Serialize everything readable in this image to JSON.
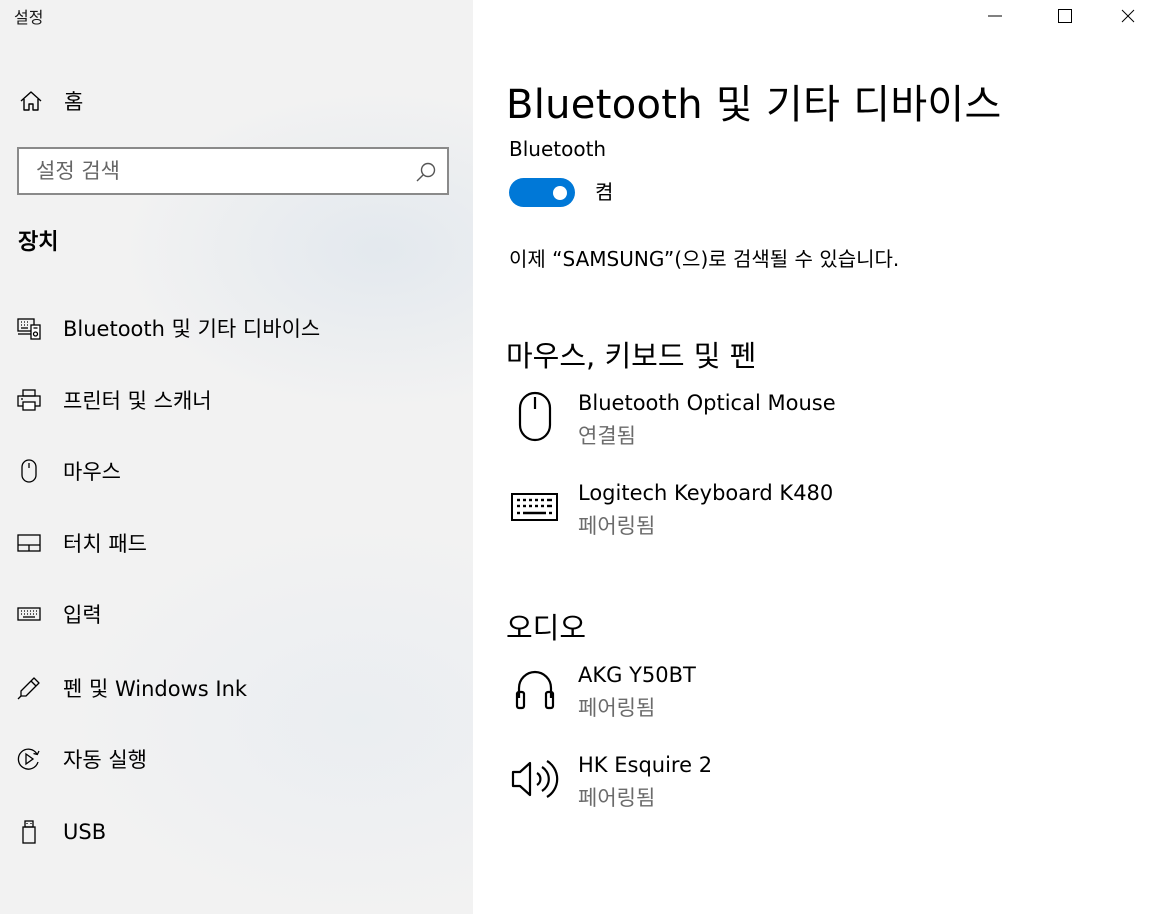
{
  "window": {
    "title": "설정"
  },
  "sidebar": {
    "home_label": "홈",
    "search_placeholder": "설정 검색",
    "section_title": "장치",
    "items": [
      {
        "label": "Bluetooth 및 기타 디바이스",
        "icon": "bluetooth-devices-icon"
      },
      {
        "label": "프린터 및 스캐너",
        "icon": "printer-icon"
      },
      {
        "label": "마우스",
        "icon": "mouse-icon"
      },
      {
        "label": "터치 패드",
        "icon": "touchpad-icon"
      },
      {
        "label": "입력",
        "icon": "keyboard-icon"
      },
      {
        "label": "펜 및 Windows Ink",
        "icon": "pen-icon"
      },
      {
        "label": "자동 실행",
        "icon": "autoplay-icon"
      },
      {
        "label": "USB",
        "icon": "usb-icon"
      }
    ]
  },
  "main": {
    "page_title": "Bluetooth 및 기타 디바이스",
    "bluetooth_label": "Bluetooth",
    "toggle_state": "켬",
    "toggle_on": true,
    "discoverable_text": "이제 “SAMSUNG”(으)로 검색될 수 있습니다.",
    "groups": [
      {
        "title": "마우스, 키보드 및 펜",
        "devices": [
          {
            "name": "Bluetooth Optical Mouse",
            "status": "연결됨",
            "icon": "mouse-icon"
          },
          {
            "name": "Logitech Keyboard K480",
            "status": "페어링됨",
            "icon": "keyboard-icon"
          }
        ]
      },
      {
        "title": "오디오",
        "devices": [
          {
            "name": "AKG Y50BT",
            "status": "페어링됨",
            "icon": "headphones-icon"
          },
          {
            "name": "HK Esquire 2",
            "status": "페어링됨",
            "icon": "speaker-icon"
          }
        ]
      }
    ]
  },
  "colors": {
    "accent": "#0078d7",
    "sidebar_bg": "#f2f2f2",
    "secondary_text": "#6b6b6b"
  }
}
